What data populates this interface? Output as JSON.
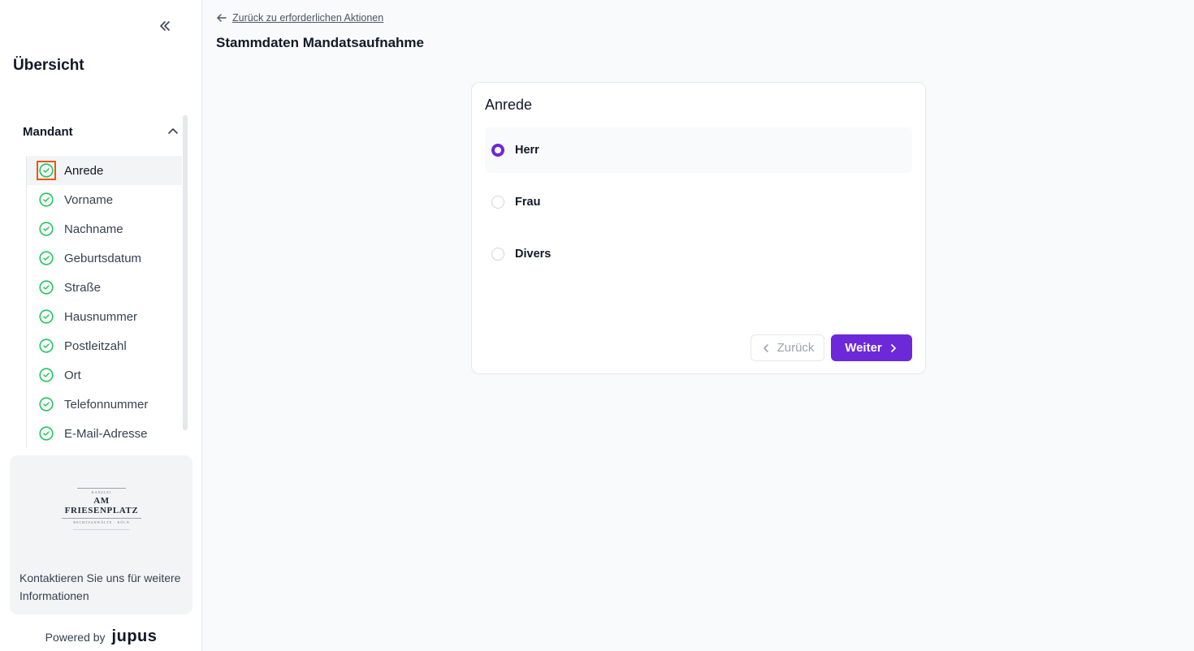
{
  "sidebar": {
    "collapse_icon": "double-chevron-left-icon",
    "title": "Übersicht",
    "section": {
      "label": "Mandant",
      "items": [
        {
          "label": "Anrede",
          "active": true
        },
        {
          "label": "Vorname"
        },
        {
          "label": "Nachname"
        },
        {
          "label": "Geburtsdatum"
        },
        {
          "label": "Straße"
        },
        {
          "label": "Hausnummer"
        },
        {
          "label": "Postleitzahl"
        },
        {
          "label": "Ort"
        },
        {
          "label": "Telefonnummer"
        },
        {
          "label": "E-Mail-Adresse"
        }
      ]
    },
    "info_card": {
      "logo_top": "KANZLEI",
      "logo_name": "AM FRIESENPLATZ",
      "logo_sub": "RECHTSANWÄLTE · KÖLN",
      "text": "Kontaktieren Sie uns für weitere Informationen"
    },
    "powered_label": "Powered by",
    "powered_brand": "jupus"
  },
  "main": {
    "back_link": "Zurück zu erforderlichen Aktionen",
    "page_title": "Stammdaten Mandatsaufnahme",
    "card": {
      "title": "Anrede",
      "options": [
        {
          "label": "Herr",
          "selected": true
        },
        {
          "label": "Frau",
          "selected": false
        },
        {
          "label": "Divers",
          "selected": false
        }
      ],
      "back_button": "Zurück",
      "next_button": "Weiter"
    }
  },
  "colors": {
    "accent": "#6d28d9",
    "success": "#22c55e",
    "highlight": "#ea580c"
  }
}
